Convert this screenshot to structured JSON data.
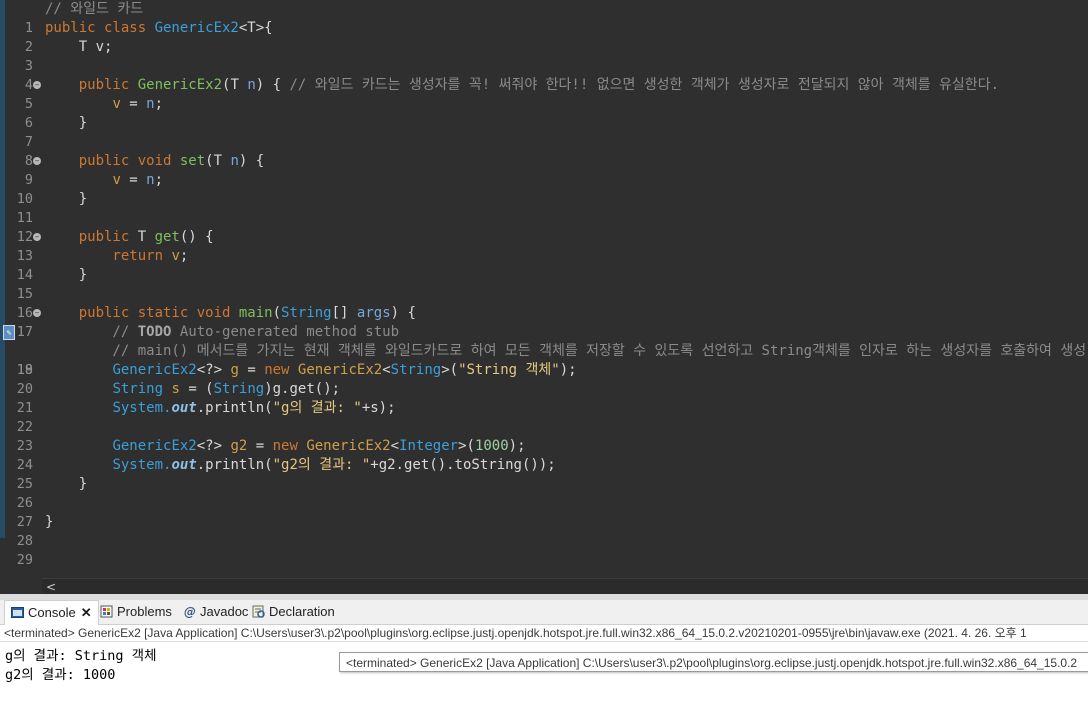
{
  "editor": {
    "line_numbers": [
      "1",
      "2",
      "3",
      "4",
      "5",
      "6",
      "7",
      "8",
      "9",
      "10",
      "11",
      "12",
      "13",
      "14",
      "15",
      "16",
      "17",
      "18",
      "19",
      "20",
      "21",
      "22",
      "23",
      "24",
      "25",
      "26",
      "27",
      "28",
      "29"
    ],
    "code": {
      "l1": "// 와일드 카드",
      "l2_kw": "public class ",
      "l2_type": "GenericEx2",
      "l2_rest": "<T>{",
      "l3": "    T v;",
      "l5_kw": "    public ",
      "l5_fn": "GenericEx2",
      "l5_a": "(T ",
      "l5_p": "n",
      "l5_b": ") { ",
      "l5_cm": "// 와일드 카드는 생성자를 꼭! 써줘야 한다!! 없으면 생성한 객체가 생성자로 전달되지 않아 객체를 유실한다.",
      "l6_a": "        ",
      "l6_f": "v",
      "l6_b": " = ",
      "l6_p": "n",
      "l6_c": ";",
      "l7": "    }",
      "l9_kw": "    public void ",
      "l9_fn": "set",
      "l9_a": "(T ",
      "l9_p": "n",
      "l9_b": ") {",
      "l10_a": "        ",
      "l10_f": "v",
      "l10_b": " = ",
      "l10_p": "n",
      "l10_c": ";",
      "l11": "    }",
      "l13_kw": "    public ",
      "l13_t": "T ",
      "l13_fn": "get",
      "l13_b": "() {",
      "l14_kw": "        return ",
      "l14_f": "v",
      "l14_c": ";",
      "l15": "    }",
      "l17_kw": "    public static void ",
      "l17_fn": "main",
      "l17_a": "(",
      "l17_t": "String",
      "l17_b": "[] ",
      "l17_p": "args",
      "l17_c": ") {",
      "l18_a": "        // ",
      "l18_tag": "TODO",
      "l18_b": " Auto-generated method stub",
      "l19": "        // main() 메서드를 가지는 현재 객체를 와일드카드로 하여 모든 객체를 저장할 수 있도록 선언하고 String객체를 인자로 하는 생성자를 호출하여 생성",
      "l20_a": "        ",
      "l20_t": "GenericEx2",
      "l20_b": "<?> ",
      "l20_v": "g",
      "l20_c": " = ",
      "l20_kw": "new ",
      "l20_t2": "GenericEx2",
      "l20_d": "<",
      "l20_t3": "String",
      "l20_e": ">(",
      "l20_s": "\"String 객체\"",
      "l20_f": ");",
      "l21_a": "        ",
      "l21_t": "String",
      "l21_b": " ",
      "l21_v": "s",
      "l21_c": " = (",
      "l21_t2": "String",
      "l21_d": ")g.get();",
      "l22_a": "        ",
      "l22_sys": "System.",
      "l22_out": "out",
      "l22_b": ".println(",
      "l22_s": "\"g의 결과: \"",
      "l22_c": "+s);",
      "l24_a": "        ",
      "l24_t": "GenericEx2",
      "l24_b": "<?> ",
      "l24_v": "g2",
      "l24_c": " = ",
      "l24_kw": "new ",
      "l24_t2": "GenericEx2",
      "l24_d": "<",
      "l24_t3": "Integer",
      "l24_e": ">(",
      "l24_n": "1000",
      "l24_f": ");",
      "l25_a": "        ",
      "l25_sys": "System.",
      "l25_out": "out",
      "l25_b": ".println(",
      "l25_s": "\"g2의 결과: \"",
      "l25_c": "+g2.get().toString());",
      "l26": "    }",
      "l28": "}"
    },
    "hscroll_arrow": "<"
  },
  "tabs": [
    {
      "label": "Console",
      "icon": "console-icon",
      "close": "✕"
    },
    {
      "label": "Problems",
      "icon": "problems-icon"
    },
    {
      "label": "Javadoc",
      "icon": "javadoc-icon"
    },
    {
      "label": "Declaration",
      "icon": "declaration-icon"
    }
  ],
  "console": {
    "header": "<terminated> GenericEx2 [Java Application] C:\\Users\\user3\\.p2\\pool\\plugins\\org.eclipse.justj.openjdk.hotspot.jre.full.win32.x86_64_15.0.2.v20210201-0955\\jre\\bin\\javaw.exe  (2021. 4. 26. 오후 1",
    "output": [
      "g의 결과: String 객체",
      "g2의 결과: 1000"
    ],
    "tooltip": "<terminated> GenericEx2 [Java Application] C:\\Users\\user3\\.p2\\pool\\plugins\\org.eclipse.justj.openjdk.hotspot.jre.full.win32.x86_64_15.0.2"
  },
  "colors": {
    "editor_bg": "#2f2f2f",
    "keyword": "#cc7832",
    "type": "#3b9fd8",
    "comment": "#8b8b8b",
    "string": "#e2c882"
  }
}
